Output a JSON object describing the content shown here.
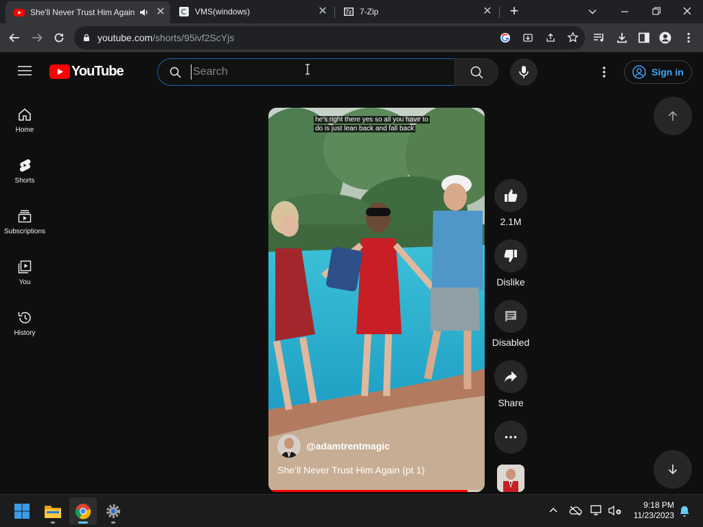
{
  "browser": {
    "tabs": [
      {
        "title": "She'll Never Trust Him Again",
        "favicon": "youtube-favicon",
        "audio": "speaker-icon",
        "active": true
      },
      {
        "title": "VMS(windows)",
        "favicon": "page-favicon",
        "active": false
      },
      {
        "title": "7-Zip",
        "favicon": "7zip-favicon",
        "active": false
      }
    ],
    "new_tab": "+",
    "url_host": "youtube.com",
    "url_path": "/shorts/95ivf2ScYjs"
  },
  "youtube": {
    "logo_text": "YouTube",
    "search": {
      "placeholder": "Search",
      "value": ""
    },
    "sign_in": "Sign in",
    "sidebar": [
      {
        "label": "Home",
        "icon": "home-icon"
      },
      {
        "label": "Shorts",
        "icon": "shorts-icon"
      },
      {
        "label": "Subscriptions",
        "icon": "subscriptions-icon"
      },
      {
        "label": "You",
        "icon": "library-icon"
      },
      {
        "label": "History",
        "icon": "history-icon"
      }
    ],
    "short": {
      "caption_line1": "he's right there yes so all you have to",
      "caption_line2": "do is just lean back and fall back",
      "channel": "@adamtrentmagic",
      "title": "She’ll Never Trust Him Again (pt 1)",
      "progress": 0.92
    },
    "actions": {
      "like_count": "2.1M",
      "dislike_label": "Dislike",
      "comments_label": "Disabled",
      "share_label": "Share"
    }
  },
  "taskbar": {
    "apps": [
      "start-icon",
      "file-explorer-icon",
      "chrome-icon",
      "settings-icon"
    ],
    "time": "9:18 PM",
    "date": "11/23/2023"
  },
  "colors": {
    "youtube_red": "#ff0000",
    "link_blue": "#3ea6ff",
    "bg": "#0f0f0f"
  }
}
